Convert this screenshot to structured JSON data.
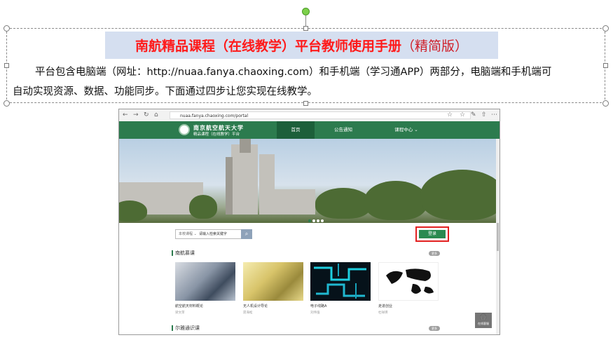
{
  "document": {
    "title_main": "南航精品课程（在线教学）平台教师使用手册",
    "title_version": "（精简版）",
    "intro_line1": "平台包含电脑端（网址：http://nuaa.fanya.chaoxing.com）和手机端（学习通APP）两部分，电脑端和手机端可",
    "intro_line2": "自动实现资源、数据、功能同步。下面通过四步让您实现在线教学。"
  },
  "portal": {
    "url": "nuaa.fanya.chaoxing.com/portal",
    "logo_name": "南京航空航天大学",
    "logo_subtitle": "精品课程（在线教学）平台",
    "nav": {
      "home": "首页",
      "notice": "公告通知",
      "courses": "课程中心 ⌄"
    },
    "search": {
      "scope": "本校课程 ⌄",
      "placeholder": "请输入检索关键字"
    },
    "login_label": "登录",
    "section1_title": "南航慕课",
    "section2_title": "尔雅通识课",
    "more_label": "更多",
    "courses": [
      {
        "name": "航空航天材料概论",
        "teacher": "梁文萍"
      },
      {
        "name": "无人机设计导论",
        "teacher": "昂海松"
      },
      {
        "name": "电子线路A",
        "teacher": "刘伟强"
      },
      {
        "name": "走进创业",
        "teacher": "杜祥瑛"
      }
    ],
    "assistant_label": "在线客服"
  },
  "colors": {
    "title_red": "#ff1a1a",
    "title_highlight": "#d5dff0",
    "portal_green": "#2c7b4e",
    "login_outline": "#e32020"
  }
}
